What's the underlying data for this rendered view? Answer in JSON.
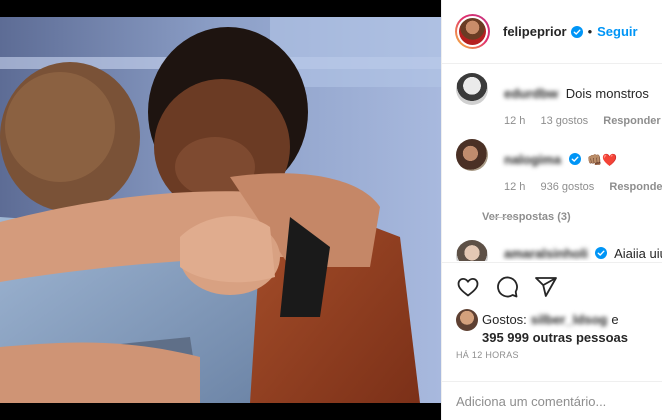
{
  "post": {
    "author": "felipeprior",
    "follow_label": "Seguir",
    "separator": "•"
  },
  "comments": [
    {
      "user": "edurdbw",
      "text": "Dois monstros",
      "time": "12 h",
      "likes": "13 gostos",
      "reply": "Responder"
    },
    {
      "user": "nalogima",
      "text": "",
      "time": "12 h",
      "likes": "936 gostos",
      "reply": "Responder",
      "emoji": "👊🏽❤️"
    },
    {
      "user": "amaralsinholi",
      "text": "Aiaiia uiuiu"
    }
  ],
  "view_replies": "Ver respostas (3)",
  "likes_summary": {
    "prefix": "Gostos:",
    "blurred_user": "silber_ldsog",
    "conjunction": "e",
    "others": "395 999 outras pessoas"
  },
  "time_ago": "HÁ 12 HORAS",
  "add_comment": {
    "placeholder": "Adiciona um comentário..."
  },
  "colors": {
    "link_blue": "#0095f6",
    "heart_red": "#ed4956",
    "muted_gray": "#8e8e8e",
    "text_dark": "#262626"
  },
  "icons": [
    "heart-icon",
    "comment-icon",
    "share-icon",
    "verified-icon"
  ]
}
